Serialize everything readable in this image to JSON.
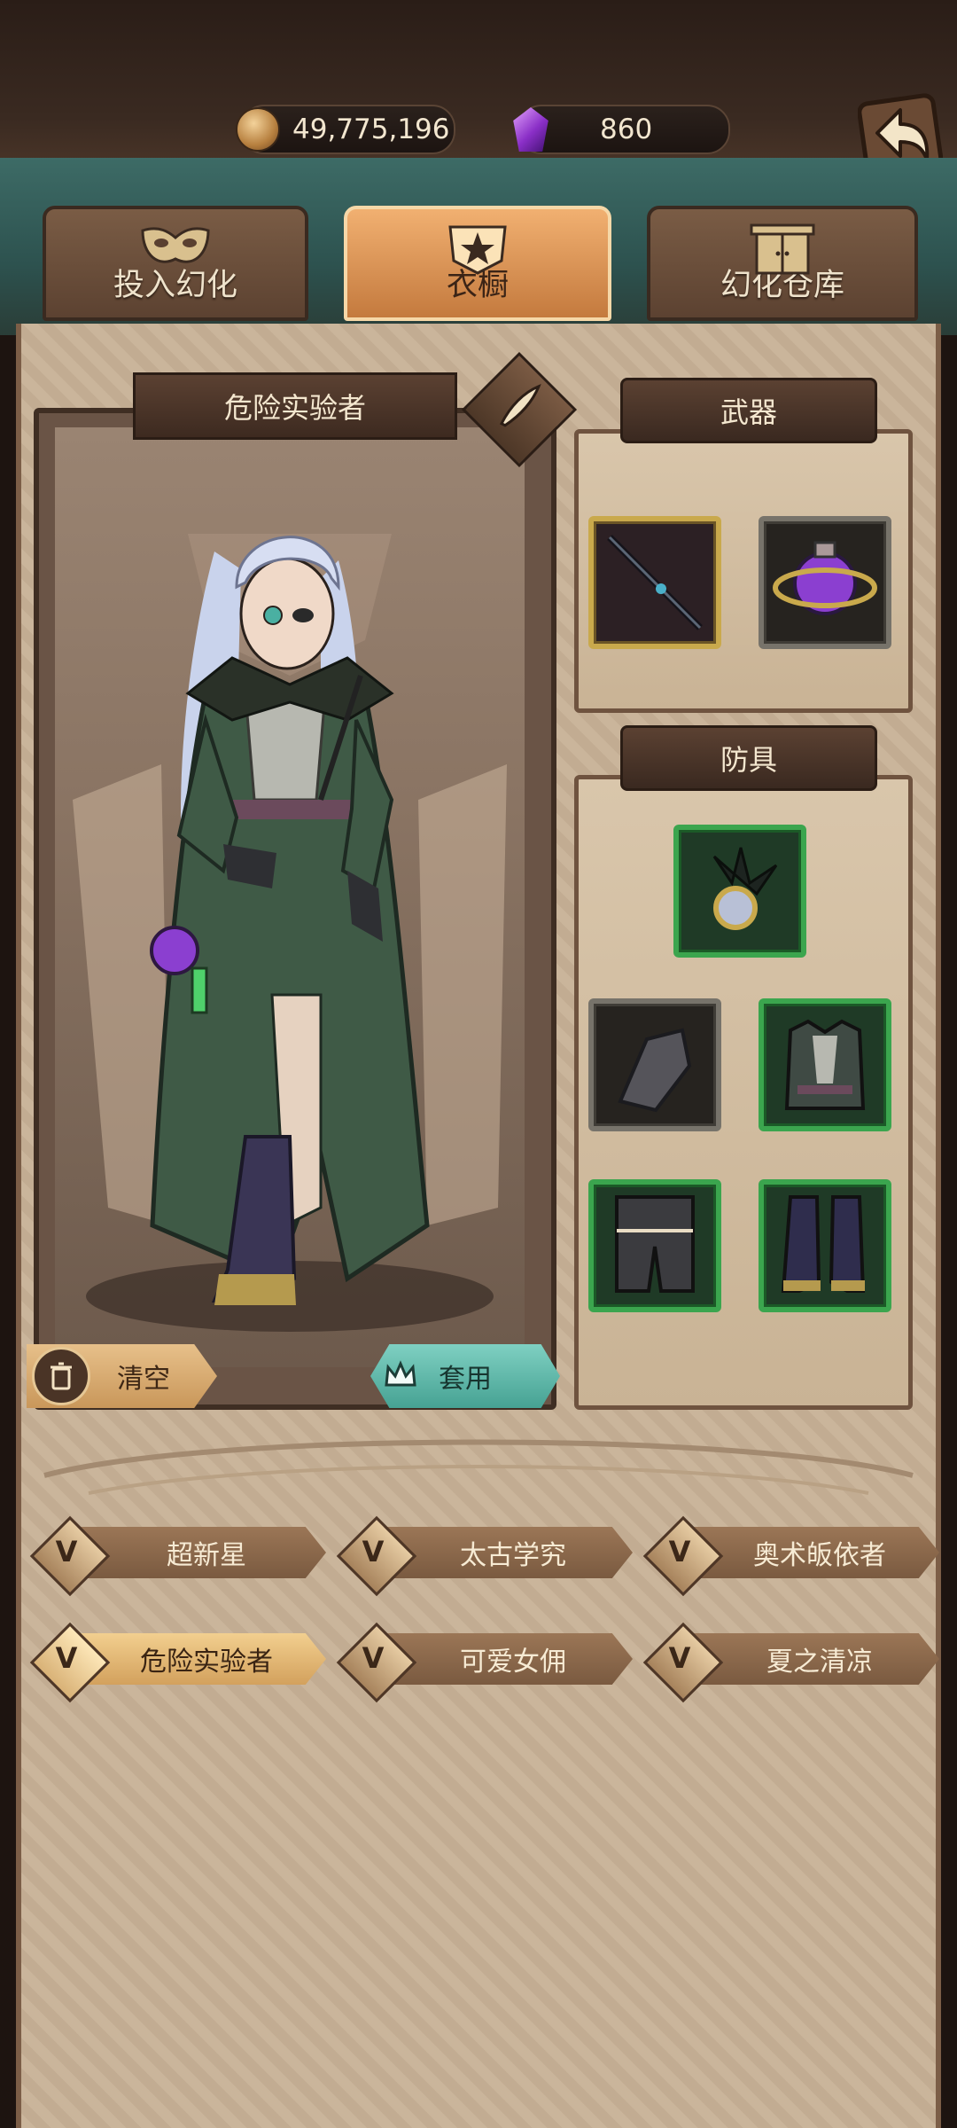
{
  "resources": {
    "coins": "49,775,196",
    "gems": "860"
  },
  "icons": {
    "coin": "coin-icon",
    "gem": "purple-gem-icon",
    "back": "back-arrow-icon",
    "clear": "trash-icon",
    "apply": "crown-icon",
    "outfit_badge": "v-emblem-icon"
  },
  "tabs": [
    {
      "label": "投入幻化",
      "active": false
    },
    {
      "label": "衣橱",
      "active": true
    },
    {
      "label": "幻化仓库",
      "active": false
    }
  ],
  "character": {
    "outfit_name": "危险实验者"
  },
  "buttons": {
    "clear": "清空",
    "apply": "套用"
  },
  "weapons": {
    "title": "武器",
    "slots": [
      {
        "item": "dark-staff",
        "rarity": "gold"
      },
      {
        "item": "purple-potion-orb",
        "rarity": "gray"
      }
    ]
  },
  "armor": {
    "title": "防具",
    "slots": [
      {
        "item": "feathered-mirror-headpiece",
        "rarity": "green"
      },
      {
        "item": "dark-gauntlet",
        "rarity": "gray"
      },
      {
        "item": "feathered-coat",
        "rarity": "green"
      },
      {
        "item": "dark-shorts",
        "rarity": "green"
      },
      {
        "item": "dark-boots",
        "rarity": "green"
      }
    ]
  },
  "outfits": [
    {
      "name": "超新星",
      "selected": false
    },
    {
      "name": "太古学究",
      "selected": false
    },
    {
      "name": "奥术皈依者",
      "selected": false
    },
    {
      "name": "危险实验者",
      "selected": true
    },
    {
      "name": "可爱女佣",
      "selected": false
    },
    {
      "name": "夏之清凉",
      "selected": false
    }
  ],
  "colors": {
    "panel": "#c8b297",
    "active_tab": "#e6a060",
    "apply_button": "#5fbcae",
    "green_rarity": "#3ba54e",
    "gold_rarity": "#c9a94c"
  }
}
